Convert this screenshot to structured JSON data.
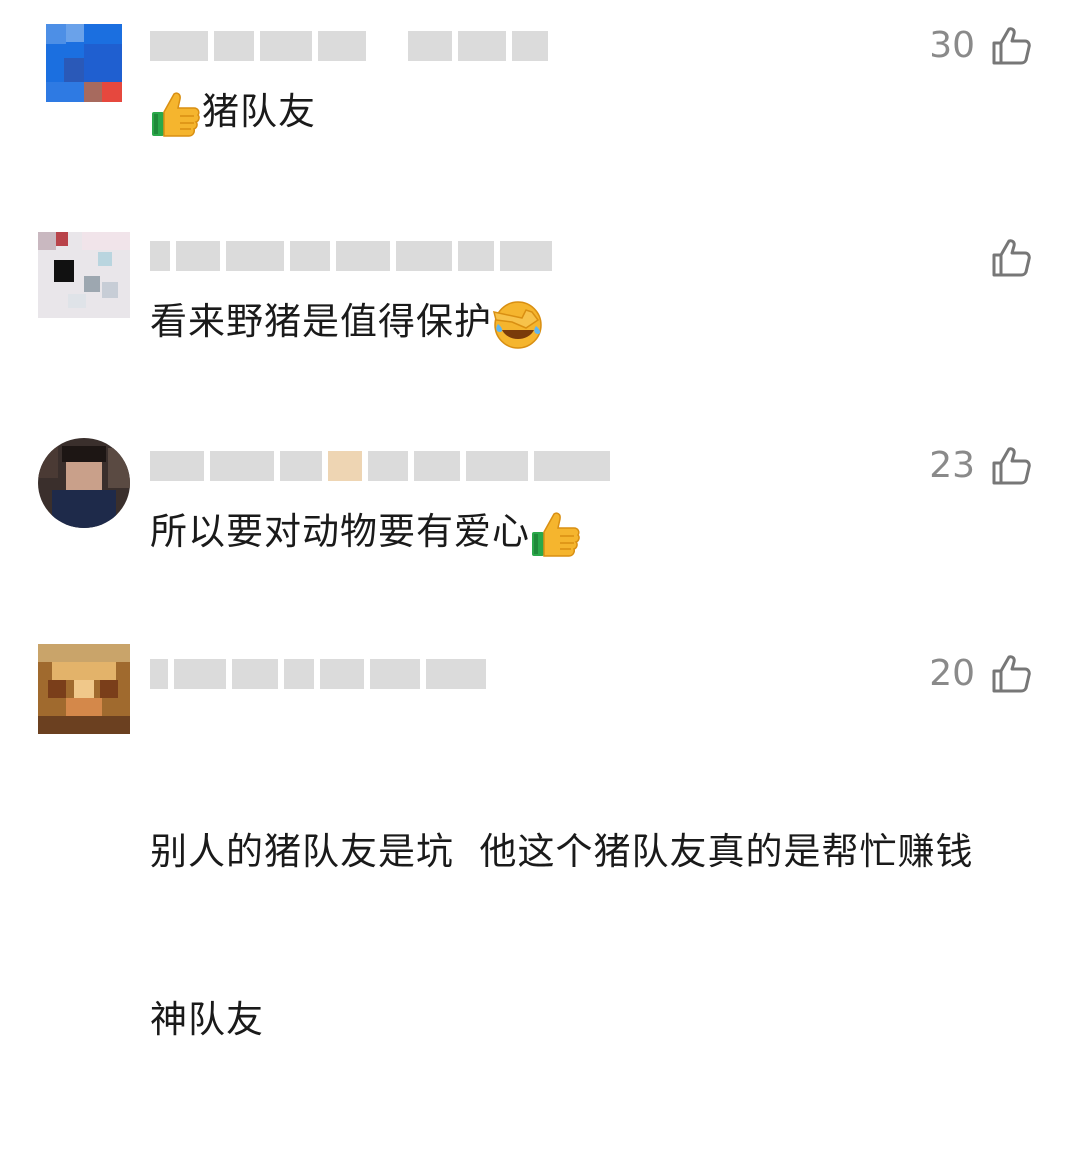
{
  "comments": [
    {
      "like_count": "30",
      "text": "猪队友",
      "emoji_prefix": "thumbs-up-emoji",
      "emoji_suffix": ""
    },
    {
      "like_count": "",
      "text": "看来野猪是值得保护",
      "emoji_prefix": "",
      "emoji_suffix": "facepalm-laugh-emoji"
    },
    {
      "like_count": "23",
      "text": "所以要对动物要有爱心",
      "emoji_prefix": "",
      "emoji_suffix": "thumbs-up-emoji"
    },
    {
      "like_count": "20",
      "text_line1": "别人的猪队友是坑  他这个猪队友真的是帮忙赚钱",
      "text_line2": "神队友"
    }
  ],
  "icons": {
    "like": "thumb-up-outline-icon",
    "thumbs_up": "thumbs-up-emoji",
    "facepalm": "facepalm-laugh-emoji"
  },
  "colors": {
    "text": "#1a1a1a",
    "meta": "#8a8a8a",
    "emoji_yellow": "#f5b52e",
    "emoji_green": "#2aa84a"
  }
}
